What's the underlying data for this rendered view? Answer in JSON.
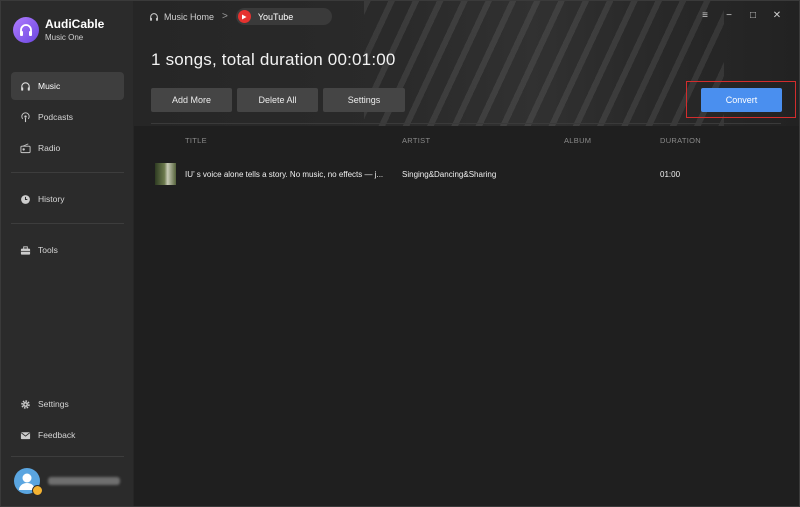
{
  "brand": {
    "name": "AudiCable",
    "subtitle": "Music One"
  },
  "sidebar": {
    "items": [
      {
        "label": "Music",
        "icon": "headphones-icon",
        "active": true
      },
      {
        "label": "Podcasts",
        "icon": "podcast-icon",
        "active": false
      },
      {
        "label": "Radio",
        "icon": "radio-icon",
        "active": false
      },
      {
        "label": "History",
        "icon": "clock-icon",
        "active": false
      },
      {
        "label": "Tools",
        "icon": "toolbox-icon",
        "active": false
      },
      {
        "label": "Settings",
        "icon": "gear-icon",
        "active": false
      },
      {
        "label": "Feedback",
        "icon": "mail-icon",
        "active": false
      }
    ]
  },
  "breadcrumb": {
    "home": "Music Home",
    "separator": ">",
    "current": "YouTube"
  },
  "window_controls": {
    "menu": "≡",
    "minimize": "−",
    "maximize": "□",
    "close": "✕"
  },
  "main": {
    "title": "1 songs, total duration 00:01:00",
    "buttons": {
      "add_more": "Add More",
      "delete_all": "Delete All",
      "settings": "Settings",
      "convert": "Convert"
    }
  },
  "table": {
    "headers": {
      "title": "TITLE",
      "artist": "ARTIST",
      "album": "ALBUM",
      "duration": "DURATION"
    },
    "rows": [
      {
        "title": "IU’ s voice alone tells a story. No music, no effects — j...",
        "artist": "Singing&Dancing&Sharing",
        "album": "",
        "duration": "01:00"
      }
    ]
  },
  "colors": {
    "accent": "#4a8fef",
    "highlight_frame": "#d22d2d",
    "youtube": "#e6322f",
    "logo": "#8a5cf0"
  }
}
